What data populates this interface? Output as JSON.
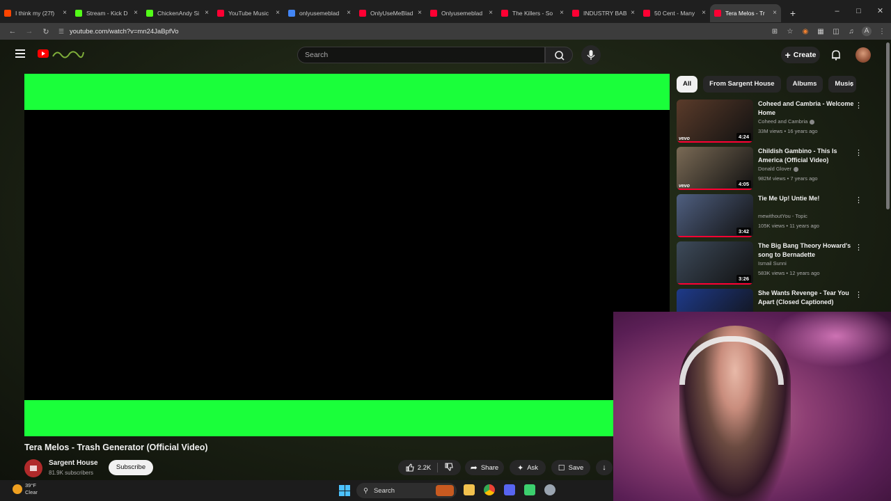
{
  "browser": {
    "tabs": [
      {
        "title": "I think my (27f)",
        "color": "#ff4500"
      },
      {
        "title": "Stream - Kick D",
        "color": "#53fc18"
      },
      {
        "title": "ChickenAndy Si",
        "color": "#53fc18"
      },
      {
        "title": "YouTube Music",
        "color": "#ff0033"
      },
      {
        "title": "onlyusemeblad",
        "color": "#4285f4"
      },
      {
        "title": "OnlyUseMeBlad",
        "color": "#ff0033"
      },
      {
        "title": "Onlyusemeblad",
        "color": "#ff0033"
      },
      {
        "title": "The Killers - So",
        "color": "#ff0033"
      },
      {
        "title": "INDUSTRY BAB",
        "color": "#ff0033"
      },
      {
        "title": "50 Cent - Many",
        "color": "#ff0033"
      },
      {
        "title": "Tera Melos - Tr",
        "color": "#ff0033"
      }
    ],
    "close_glyph": "×",
    "new_tab": "+",
    "url": "youtube.com/watch?v=mn24JaBpfVo"
  },
  "youtube": {
    "search_placeholder": "Search",
    "create_label": "Create",
    "video": {
      "title": "Tera Melos - Trash Generator (Official Video)",
      "channel": "Sargent House",
      "subscribers": "81.9K subscribers",
      "subscribe_label": "Subscribe",
      "likes": "2.2K",
      "share_label": "Share",
      "ask_label": "Ask",
      "save_label": "Save"
    },
    "chips": [
      "All",
      "From Sargent House",
      "Albums",
      "Music"
    ],
    "recommendations": [
      {
        "title": "Coheed and Cambria - Welcome Home",
        "channel": "Coheed and Cambria",
        "meta": "33M views • 16 years ago",
        "duration": "4:24",
        "thumb": "#5a3b2a",
        "vevo": "vevo"
      },
      {
        "title": "Childish Gambino - This Is America (Official Video)",
        "channel": "Donald Glover",
        "meta": "982M views • 7 years ago",
        "duration": "4:05",
        "thumb": "#7a6a55",
        "vevo": "vevo"
      },
      {
        "title": "Tie Me Up! Untie Me!",
        "channel": "mewithoutYou - Topic",
        "meta": "105K views • 11 years ago",
        "duration": "3:42",
        "thumb": "#4f5f80",
        "vevo": ""
      },
      {
        "title": "The Big Bang Theory  Howard's song to Bernadette",
        "channel": "Ismail Sunni",
        "meta": "583K views • 12 years ago",
        "duration": "3:26",
        "thumb": "#3d4a5a",
        "vevo": ""
      },
      {
        "title": "She Wants Revenge - Tear You Apart (Closed Captioned)",
        "channel": "",
        "meta": "",
        "duration": "",
        "thumb": "#1e3a8a",
        "vevo": ""
      }
    ]
  },
  "taskbar": {
    "temp": "39°F",
    "condition": "Clear",
    "search_label": "Search"
  }
}
